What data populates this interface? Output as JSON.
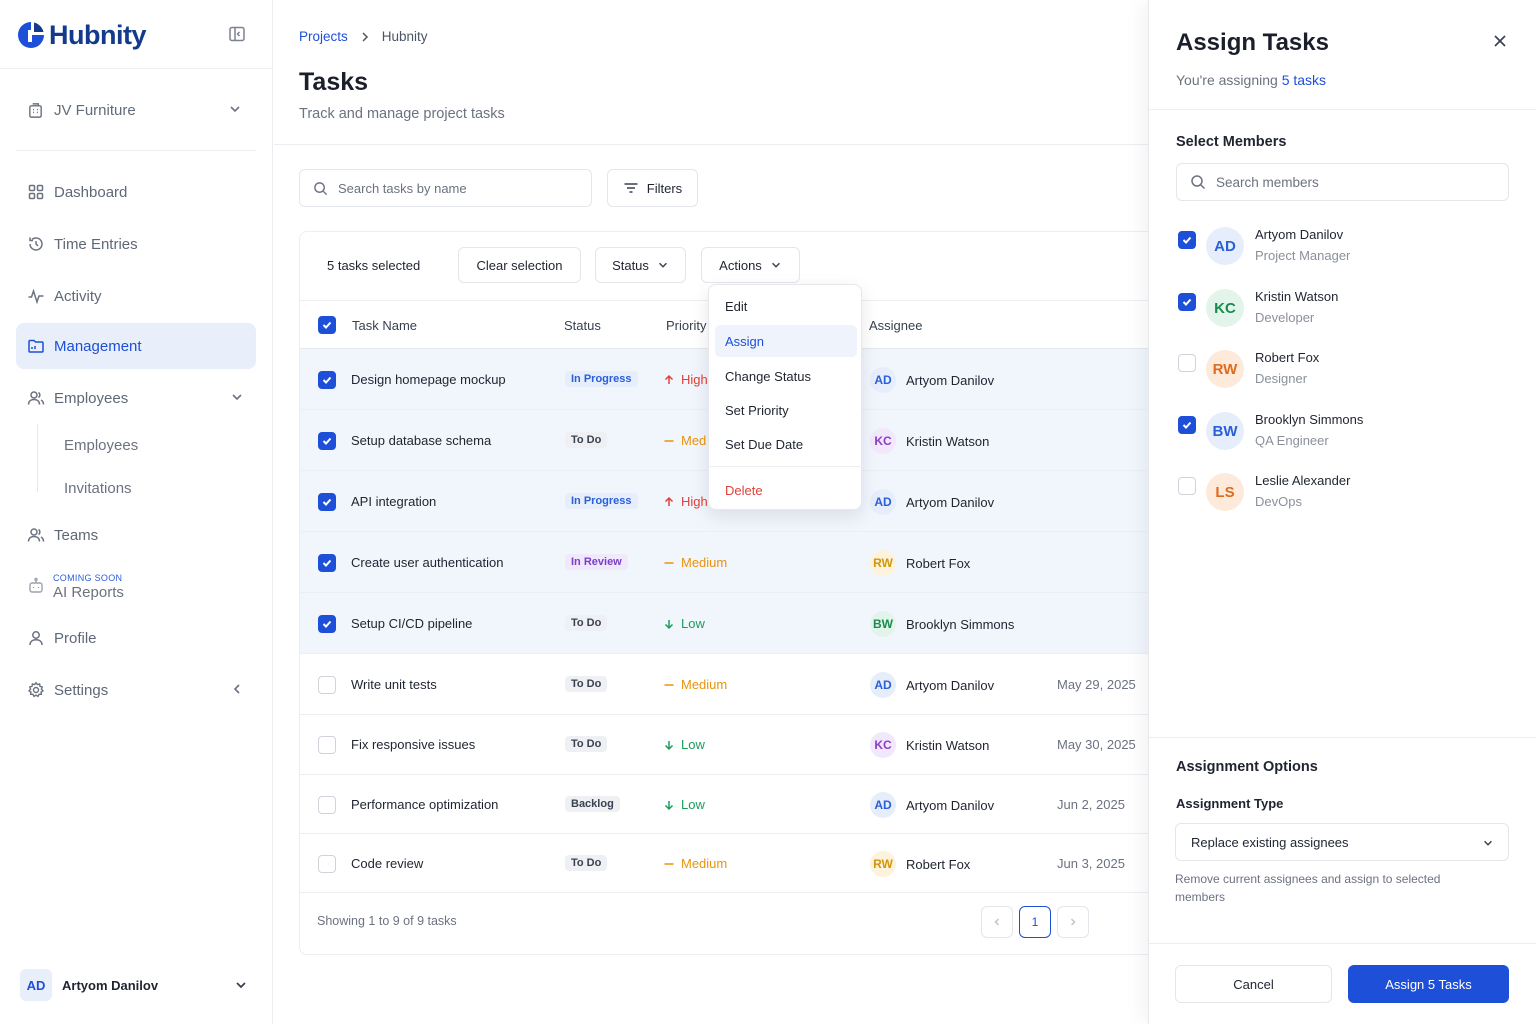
{
  "sidebar": {
    "brand": "Hubnity",
    "org": "JV Furniture",
    "nav": {
      "dashboard": "Dashboard",
      "time_entries": "Time Entries",
      "activity": "Activity",
      "management": "Management",
      "employees": "Employees",
      "teams": "Teams",
      "ai_reports": "AI Reports",
      "coming_soon": "COMING SOON",
      "profile": "Profile",
      "settings": "Settings"
    },
    "employees_sub": [
      "Employees",
      "Invitations"
    ],
    "user": {
      "initials": "AD",
      "name": "Artyom Danilov"
    }
  },
  "header": {
    "breadcrumb": [
      "Projects",
      "Hubnity"
    ],
    "title": "Tasks",
    "subtitle": "Track and manage project tasks"
  },
  "search": {
    "placeholder": "Search tasks by name"
  },
  "filters_label": "Filters",
  "toolbar": {
    "selected_text": "5 tasks selected",
    "clear_label": "Clear selection",
    "status_label": "Status",
    "actions_label": "Actions"
  },
  "table": {
    "columns": [
      "Task Name",
      "Status",
      "Priority",
      "Assignee"
    ],
    "rows": [
      {
        "name": "Design homepage mockup",
        "status": "In Progress",
        "priority": "High",
        "assignee_initials": "AD",
        "assignee": "Artyom Danilov",
        "due": "",
        "selected": true
      },
      {
        "name": "Setup database schema",
        "status": "To Do",
        "priority": "Med",
        "assignee_initials": "KC",
        "assignee": "Kristin Watson",
        "due": "",
        "selected": true
      },
      {
        "name": "API integration",
        "status": "In Progress",
        "priority": "High",
        "assignee_initials": "AD",
        "assignee": "Artyom Danilov",
        "due": "",
        "selected": true
      },
      {
        "name": "Create user authentication",
        "status": "In Review",
        "priority": "Medium",
        "assignee_initials": "RW",
        "assignee": "Robert Fox",
        "due": "",
        "selected": true
      },
      {
        "name": "Setup CI/CD pipeline",
        "status": "To Do",
        "priority": "Low",
        "assignee_initials": "BW",
        "assignee": "Brooklyn Simmons",
        "due": "",
        "selected": true
      },
      {
        "name": "Write unit tests",
        "status": "To Do",
        "priority": "Medium",
        "assignee_initials": "AD",
        "assignee": "Artyom Danilov",
        "due": "May 29, 2025",
        "selected": false
      },
      {
        "name": "Fix responsive issues",
        "status": "To Do",
        "priority": "Low",
        "assignee_initials": "KC",
        "assignee": "Kristin Watson",
        "due": "May 30, 2025",
        "selected": false
      },
      {
        "name": "Performance optimization",
        "status": "Backlog",
        "priority": "Low",
        "assignee_initials": "AD",
        "assignee": "Artyom Danilov",
        "due": "Jun 2, 2025",
        "selected": false
      },
      {
        "name": "Code review",
        "status": "To Do",
        "priority": "Medium",
        "assignee_initials": "RW",
        "assignee": "Robert Fox",
        "due": "Jun 3, 2025",
        "selected": false
      }
    ],
    "footer": "Showing 1 to 9 of 9 tasks",
    "current_page": "1"
  },
  "actions_menu": {
    "edit": "Edit",
    "assign": "Assign",
    "change_status": "Change Status",
    "set_priority": "Set Priority",
    "set_due_date": "Set Due Date",
    "delete": "Delete"
  },
  "panel": {
    "title": "Assign Tasks",
    "subtitle_prefix": "You're assigning",
    "subtitle_link": "5 tasks",
    "select_members_label": "Select Members",
    "search_placeholder": "Search members",
    "members": [
      {
        "initials": "AD",
        "name": "Artyom Danilov",
        "role": "Project Manager",
        "checked": true
      },
      {
        "initials": "KC",
        "name": "Kristin Watson",
        "role": "Developer",
        "checked": true
      },
      {
        "initials": "RW",
        "name": "Robert Fox",
        "role": "Designer",
        "checked": false
      },
      {
        "initials": "BW",
        "name": "Brooklyn Simmons",
        "role": "QA Engineer",
        "checked": true
      },
      {
        "initials": "LS",
        "name": "Leslie Alexander",
        "role": "DevOps",
        "checked": false
      }
    ],
    "options_label": "Assignment Options",
    "type_label": "Assignment Type",
    "type_value": "Replace existing assignees",
    "help": "Remove current assignees and assign to selected members",
    "cancel_label": "Cancel",
    "submit_label": "Assign 5 Tasks"
  },
  "colors": {
    "accent": "#1d4fd8",
    "brand": "#143a8c",
    "danger": "#e0413a",
    "warning": "#e8930c",
    "success": "#1a9e5a"
  }
}
